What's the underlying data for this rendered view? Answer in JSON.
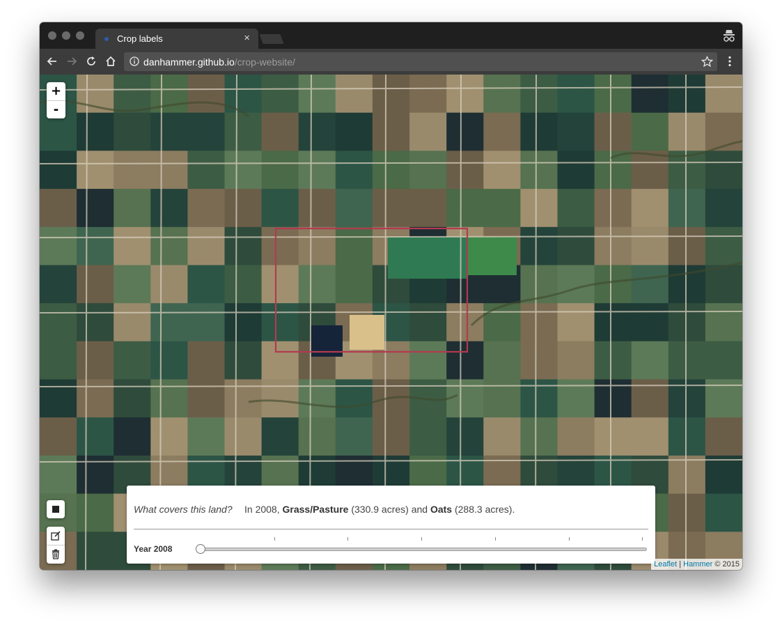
{
  "browser": {
    "tab_title": "Crop labels",
    "tab_close": "×",
    "url_host": "danhammer.github.io",
    "url_path": "/crop-website/"
  },
  "colors": {
    "tab_favicon": "#2c5ea8",
    "selection_box": "#b23a50",
    "attribution_link": "#0078a8"
  },
  "icons": [
    "back-arrow-icon",
    "forward-arrow-icon",
    "reload-icon",
    "home-icon",
    "info-icon",
    "star-icon",
    "menu-dots-icon",
    "incognito-icon",
    "square-draw-icon",
    "edit-icon",
    "trash-icon"
  ],
  "map": {
    "zoom_in": "+",
    "zoom_out": "-"
  },
  "panel": {
    "question": "What covers this land?",
    "answer_prefix": "In 2008,",
    "crop1": "Grass/Pasture",
    "crop1_acres": "(330.9 acres)",
    "conjunction": "and",
    "crop2": "Oats",
    "crop2_acres": "(288.3 acres).",
    "year_label": "Year 2008",
    "slider_position": 0
  },
  "attribution": {
    "leaflet": "Leaflet",
    "separator": "|",
    "hammer": "Hammer",
    "copyright": "© 2015"
  }
}
